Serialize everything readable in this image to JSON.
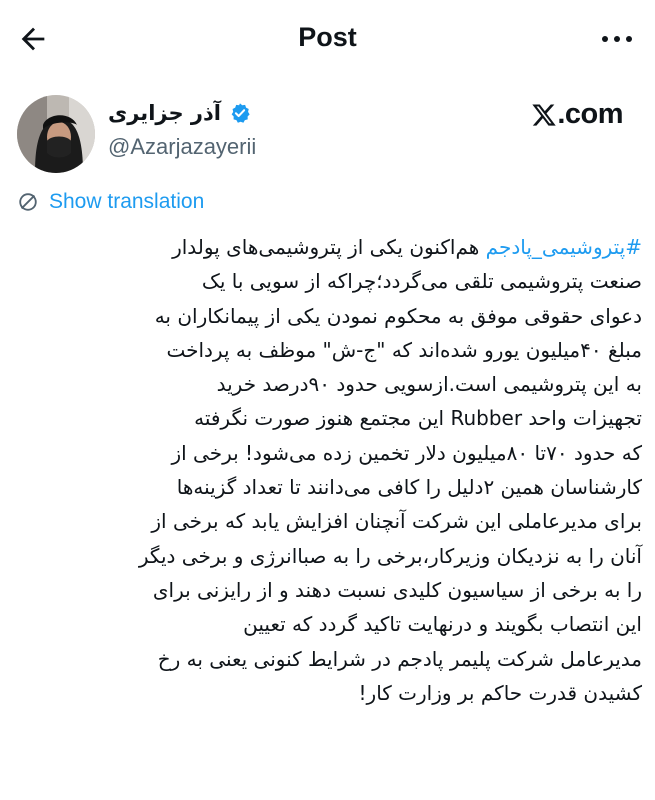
{
  "header": {
    "title": "Post"
  },
  "author": {
    "name": "آذر جزایری",
    "handle": "@Azarjazayerii"
  },
  "brand": {
    "text": ".com"
  },
  "translate": {
    "label": "Show translation"
  },
  "post": {
    "hashtag": "#پتروشیمی_پادجم",
    "first_line_rest": " هم‌اکنون یکی از پتروشیمی‌های پولدار",
    "lines": [
      "صنعت پتروشیمی تلقی می‌گردد؛چراکه از سویی با یک",
      "دعوای حقوقی موفق به محکوم نمودن یکی از پیمانکاران به",
      "مبلغ ۴۰میلیون یورو شده‌اند که \"ج-ش\" موظف به پرداخت",
      "به این پتروشیمی است.ازسویی حدود ۹۰درصد خرید",
      "تجهیزات واحد Rubber این مجتمع هنوز صورت نگرفته",
      "که حدود ۷۰تا ۸۰میلیون دلار تخمین زده می‌شود! برخی از",
      "کارشناسان همین ۲دلیل را کافی می‌دانند تا تعداد گزینه‌ها",
      "برای مدیرعاملی این شرکت آنچنان افزایش یابد که برخی از",
      "آنان را به نزدیکان وزیرکار،برخی را به صباانرژی و برخی دیگر",
      "را به برخی از سیاسیون کلیدی نسبت دهند و از رایزنی برای",
      "این انتصاب بگویند و درنهایت تاکید گردد که تعیین",
      "مدیرعامل شرکت پلیمر پادجم در شرایط کنونی یعنی به رخ",
      "کشیدن قدرت حاکم بر وزارت کار!"
    ]
  }
}
